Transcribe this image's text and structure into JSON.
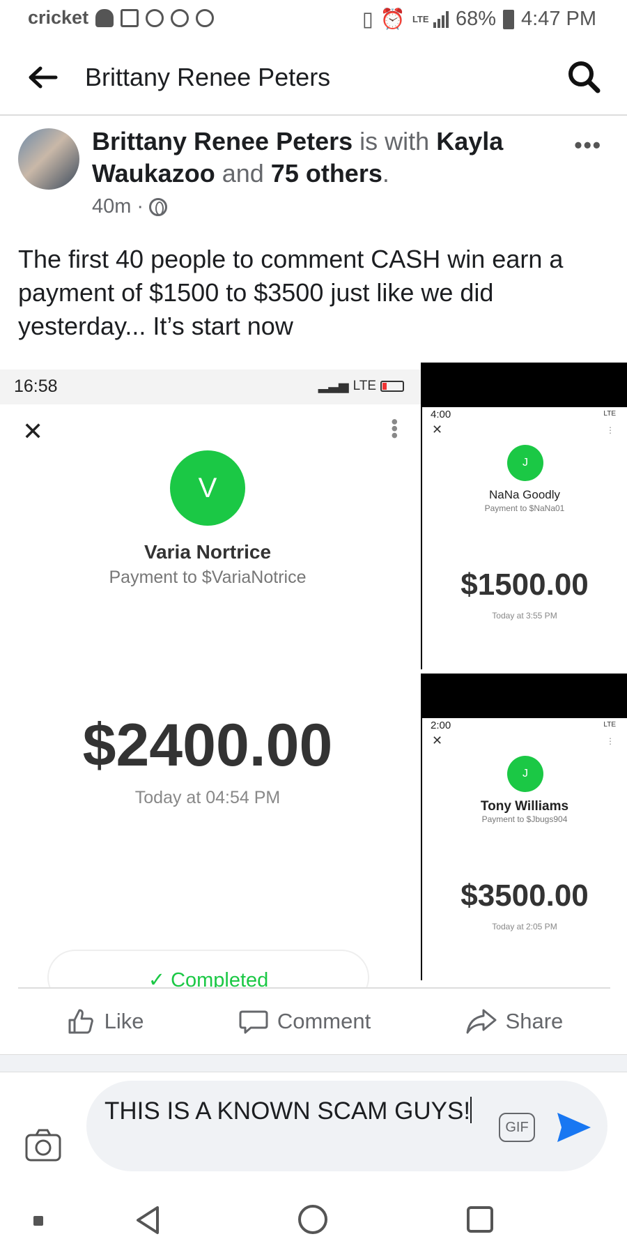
{
  "status_bar": {
    "carrier": "cricket",
    "network": "LTE",
    "battery": "68%",
    "time": "4:47 PM"
  },
  "header": {
    "title": "Brittany Renee Peters"
  },
  "post": {
    "author": "Brittany Renee Peters",
    "with_text": "is with",
    "tagged": "Kayla Waukazoo",
    "and_text": "and",
    "others": "75 others",
    "period": ".",
    "time_ago": "40m",
    "privacy_icon": "globe-icon",
    "text": "The first 40 people to comment CASH win earn a payment of $1500 to $3500 just like we did yesterday... It’s start now"
  },
  "media": {
    "main": {
      "time": "16:58",
      "network": "LTE",
      "initial": "V",
      "name": "Varia Nortrice",
      "subtitle": "Payment to $VariaNotrice",
      "amount": "$2400.00",
      "date": "Today at 04:54 PM",
      "status": "Completed"
    },
    "side1": {
      "time": "4:00",
      "network": "LTE",
      "initial": "J",
      "name": "NaNa Goodly",
      "subtitle": "Payment to $NaNa01",
      "amount": "$1500.00",
      "date": "Today at 3:55 PM"
    },
    "side2": {
      "time": "2:00",
      "network": "LTE",
      "initial": "J",
      "name": "Tony Williams",
      "subtitle": "Payment to $Jbugs904",
      "amount": "$3500.00",
      "date": "Today at 2:05 PM"
    }
  },
  "actions": {
    "like": "Like",
    "comment": "Comment",
    "share": "Share"
  },
  "composer": {
    "text": "THIS IS A KNOWN SCAM GUYS!",
    "gif_label": "GIF"
  },
  "colors": {
    "cashapp_green": "#1bc845",
    "facebook_blue": "#1877f2",
    "muted_text": "#65676b"
  }
}
